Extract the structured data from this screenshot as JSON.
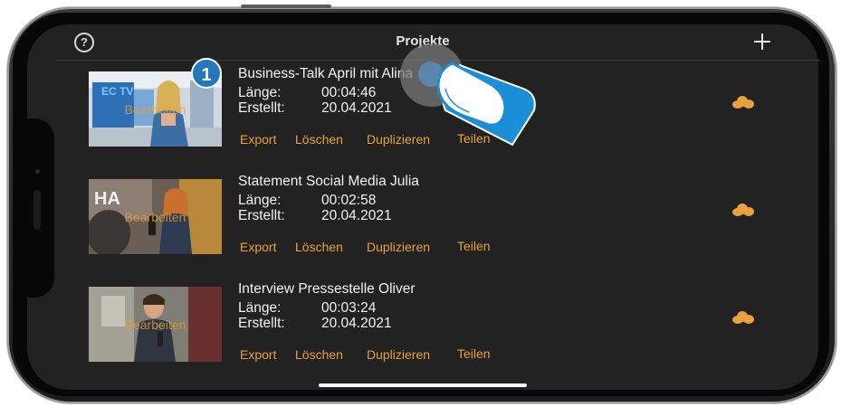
{
  "header": {
    "title": "Projekte",
    "help_icon": "?"
  },
  "projects": [
    {
      "title": "Business-Talk April mit Alina",
      "length_label": "Länge:",
      "length": "00:04:46",
      "created_label": "Erstellt:",
      "created": "20.04.2021",
      "thumb_overlay": "Bearbeiten",
      "thumb_tag": "EC TV",
      "actions": [
        "Export",
        "Löschen",
        "Duplizieren",
        "Teilen"
      ],
      "cloud_icon": "cloud-icon"
    },
    {
      "title": "Statement Social Media Julia",
      "length_label": "Länge:",
      "length": "00:02:58",
      "created_label": "Erstellt:",
      "created": "20.04.2021",
      "thumb_overlay": "Bearbeiten",
      "actions": [
        "Export",
        "Löschen",
        "Duplizieren",
        "Teilen"
      ],
      "cloud_icon": "cloud-icon"
    },
    {
      "title": "Interview Pressestelle Oliver",
      "length_label": "Länge:",
      "length": "00:03:24",
      "created_label": "Erstellt:",
      "created": "20.04.2021",
      "thumb_overlay": "Bearbeiten",
      "actions": [
        "Export",
        "Löschen",
        "Duplizieren",
        "Teilen"
      ],
      "cloud_icon": "cloud-icon"
    }
  ],
  "annotation": {
    "step_number": "1"
  },
  "colors": {
    "accent": "#E8A13A",
    "background": "#222222",
    "text": "#F2F2F2",
    "badge": "#2477B8"
  }
}
